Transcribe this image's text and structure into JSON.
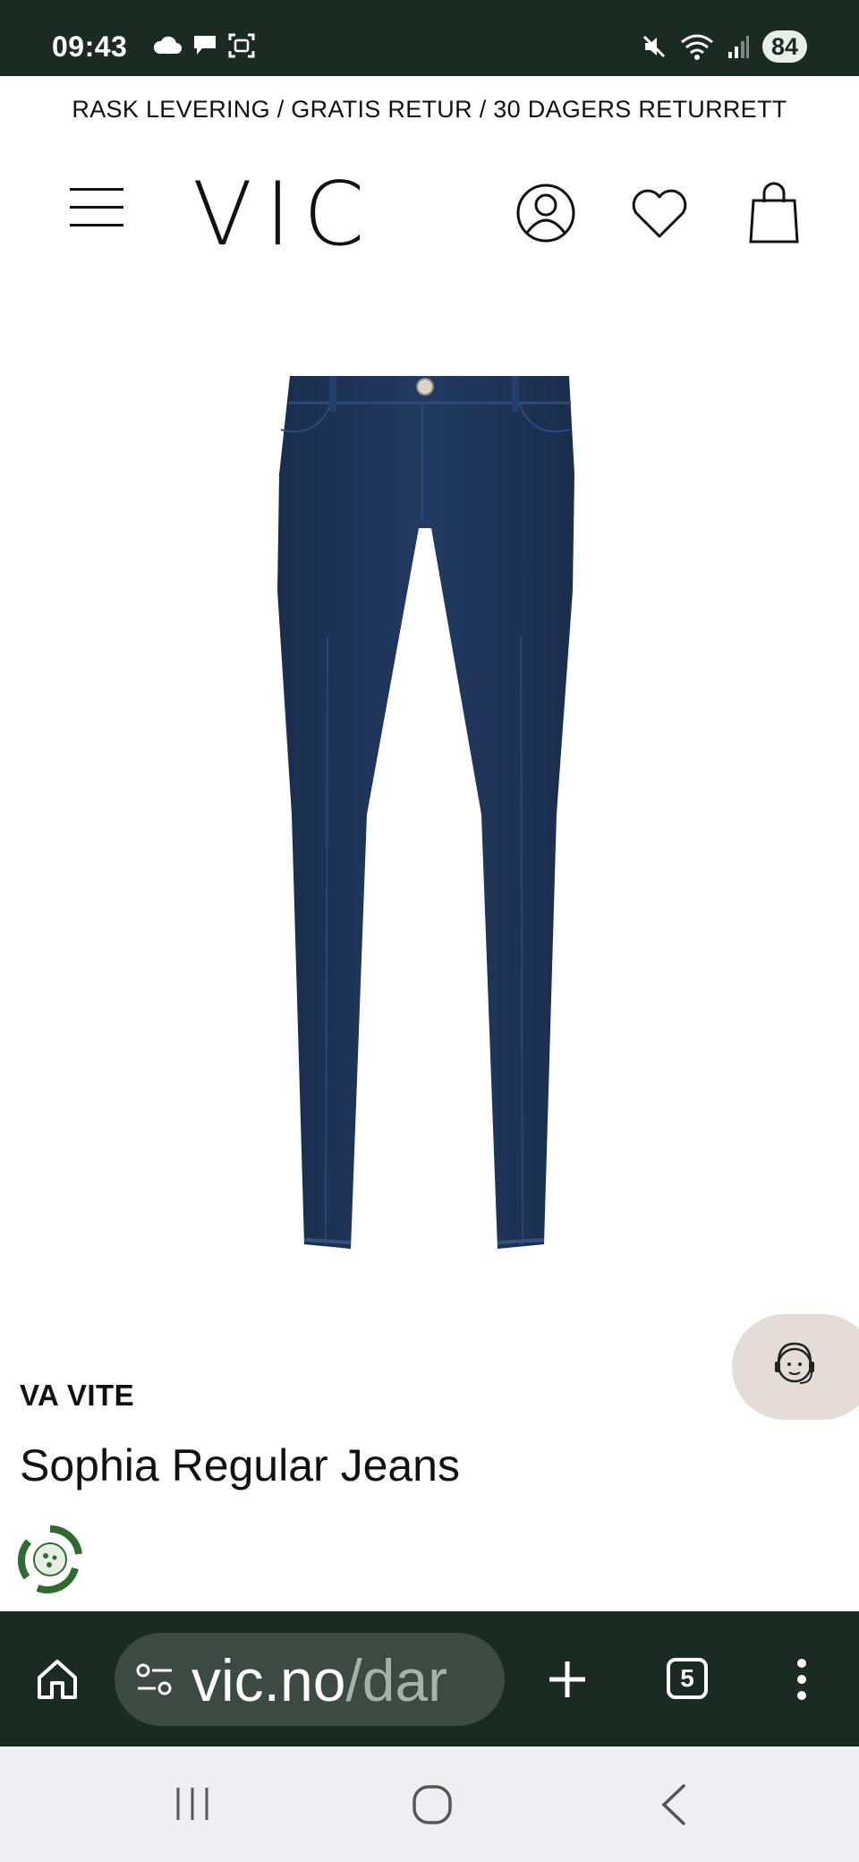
{
  "status_bar": {
    "time": "09:43",
    "battery": "84",
    "icons_left": [
      "cloud-icon",
      "chat-bubble-icon",
      "screenshot-icon"
    ],
    "icons_right": [
      "mute-icon",
      "wifi-icon",
      "signal-icon"
    ]
  },
  "promo_banner": {
    "text": "RASK LEVERING / GRATIS RETUR / 30 DAGERS RETURRETT"
  },
  "header": {
    "logo": "VIC",
    "icons": [
      "menu-icon",
      "account-icon",
      "heart-icon",
      "shopping-bag-icon"
    ]
  },
  "product": {
    "brand": "VA VITE",
    "title": "Sophia Regular Jeans",
    "image_color": "#1f3457"
  },
  "browser": {
    "url_host": "vic.no",
    "url_path": "/dar",
    "tab_count": "5"
  },
  "colors": {
    "chrome_dark": "#1c2a24",
    "chat_bubble": "#e4ddd6",
    "eco_green": "#2e6b2f"
  }
}
